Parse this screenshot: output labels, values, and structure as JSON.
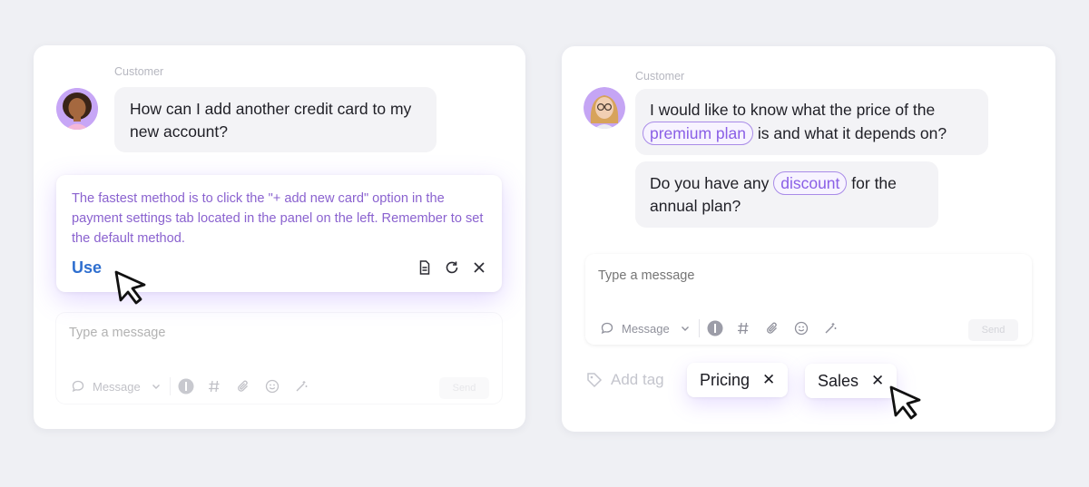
{
  "left_panel": {
    "sender_label": "Customer",
    "question": "How can I add another credit card to my new account?",
    "suggestion": {
      "text": "The fastest method is to click the \"+ add new card\" option in the payment settings tab located in the panel on the left. Remember to set the default method.",
      "use_label": "Use",
      "icons": [
        "document-icon",
        "refresh-icon",
        "close-icon"
      ]
    },
    "composer": {
      "placeholder": "Type a message",
      "mode_label": "Message",
      "send_label": "Send"
    }
  },
  "right_panel": {
    "sender_label": "Customer",
    "message1": {
      "before": "I would like to know what the price of the",
      "highlight": "premium plan",
      "after": "is and what it depends on?"
    },
    "message2": {
      "before": "Do you have any",
      "highlight": "discount",
      "after_line1": "for the",
      "after_line2": "annual plan?"
    },
    "composer": {
      "placeholder": "Type a message",
      "mode_label": "Message",
      "send_label": "Send"
    },
    "tags": {
      "add_label": "Add tag",
      "items": [
        "Pricing",
        "Sales"
      ]
    }
  },
  "colors": {
    "background": "#eff0f4",
    "accent_purple": "#8a62cf",
    "use_blue": "#2f6fcf",
    "chip_border": "#a98be8"
  }
}
